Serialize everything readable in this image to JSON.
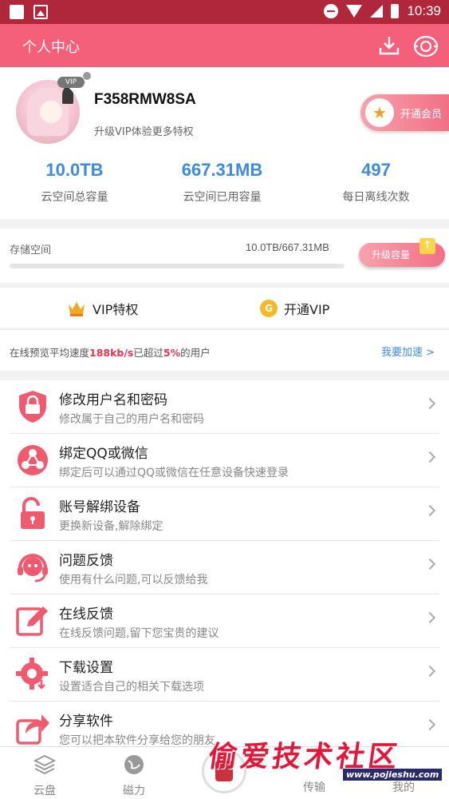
{
  "status_bar": {
    "time": "10:39"
  },
  "header": {
    "title": "个人中心"
  },
  "profile": {
    "vip_badge": "VIP",
    "username": "F358RMW8SA",
    "subtitle": "升级VIP体验更多特权",
    "open_member_label": "开通会员"
  },
  "stats": [
    {
      "value": "10.0TB",
      "label": "云空间总容量"
    },
    {
      "value": "667.31MB",
      "label": "云空间已用容量"
    },
    {
      "value": "497",
      "label": "每日离线次数"
    }
  ],
  "storage": {
    "label": "存储空间",
    "value": "10.0TB/667.31MB",
    "usage_fraction": 0.0,
    "upgrade_label": "升级容量"
  },
  "vip_row": {
    "privilege_label": "VIP特权",
    "open_vip_label": "开通VIP"
  },
  "speed": {
    "prefix": "在线预览平均速度",
    "speed": "188kb/s",
    "middle": "已超过",
    "percent": "5%",
    "suffix": "的用户",
    "link": "我要加速 >"
  },
  "menu": [
    {
      "title": "修改用户名和密码",
      "desc": "修改属于自己的用户名和密码",
      "icon": "shield-icon"
    },
    {
      "title": "绑定QQ或微信",
      "desc": "绑定后可以通过QQ或微信在任意设备快速登录",
      "icon": "link-icon"
    },
    {
      "title": "账号解绑设备",
      "desc": "更换新设备,解除绑定",
      "icon": "unlock-icon"
    },
    {
      "title": "问题反馈",
      "desc": "使用有什么问题,可以反馈给我",
      "icon": "headset-icon"
    },
    {
      "title": "在线反馈",
      "desc": "在线反馈问题,留下您宝贵的建议",
      "icon": "edit-icon"
    },
    {
      "title": "下载设置",
      "desc": "设置适合自己的相关下载选项",
      "icon": "gear-download-icon"
    },
    {
      "title": "分享软件",
      "desc": "您可以把本软件分享给您的朋友",
      "icon": "share-icon"
    }
  ],
  "bottom_nav": [
    {
      "label": "云盘"
    },
    {
      "label": "磁力"
    },
    {
      "label": "传输"
    },
    {
      "label": "我的"
    }
  ],
  "watermark": {
    "text": "偷爱技术社区",
    "url": "www.pojieshu.com"
  },
  "colors": {
    "accent": "#f4607a",
    "status_bar": "#b0263b",
    "link": "#3d8be0",
    "highlight": "#e7344d"
  }
}
